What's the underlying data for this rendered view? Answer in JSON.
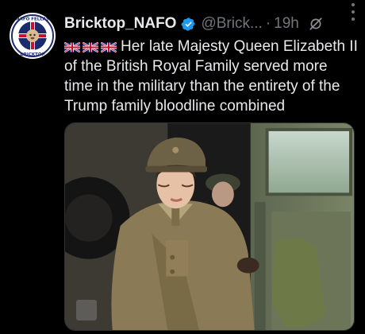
{
  "tweet": {
    "author": {
      "display_name": "Bricktop_NAFO",
      "handle": "@Brick...",
      "verified": true,
      "avatar": {
        "label_top": "NAFO FELLAS",
        "label_bottom": "BRICKTOP"
      }
    },
    "separator": "·",
    "time": "19h",
    "icons": {
      "verified": "verified-badge-icon",
      "grok": "grok-icon",
      "more": "more-options-icon"
    },
    "flags": [
      "union-jack-flag",
      "union-jack-flag",
      "union-jack-flag"
    ],
    "text": "Her late Majesty Queen Elizabeth II of the British Royal Family served more time in the military than the entirety of the Trump family bloodline combined",
    "media": {
      "type": "photo"
    },
    "colors": {
      "background": "#000000",
      "primary_text": "#e7e9ea",
      "secondary_text": "#71767b",
      "verified_blue": "#1d9bf0"
    }
  }
}
